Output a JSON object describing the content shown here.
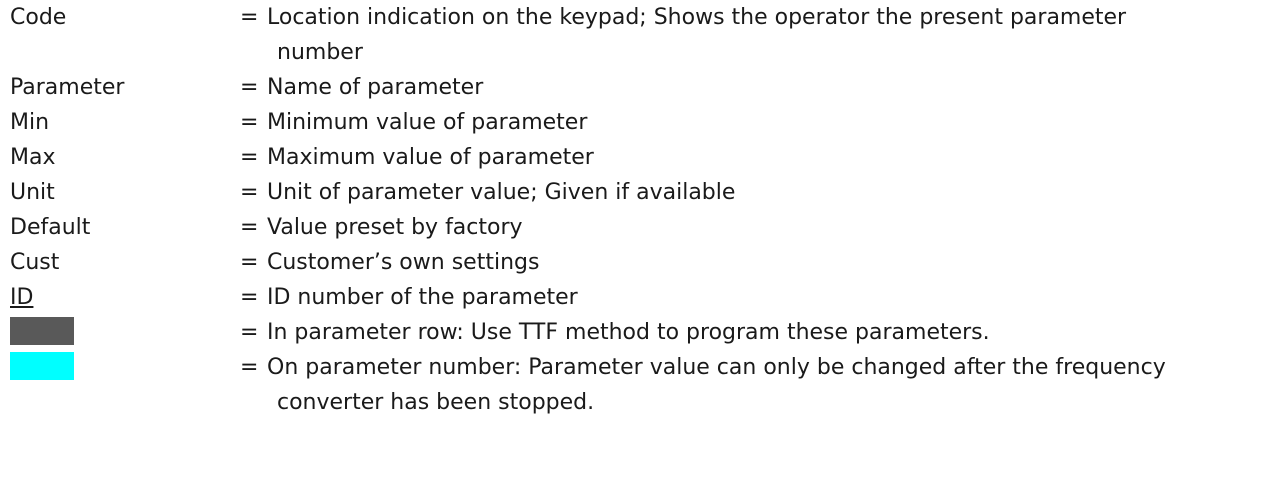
{
  "legend": [
    {
      "term": "Code",
      "definition": "Location indication on the keypad; Shows the operator the present parameter",
      "continuation": "number"
    },
    {
      "term": "Parameter",
      "definition": "Name of parameter"
    },
    {
      "term": "Min",
      "definition": "Minimum value of parameter"
    },
    {
      "term": "Max",
      "definition": "Maximum value of parameter"
    },
    {
      "term": "Unit",
      "definition": "Unit of parameter value; Given if available"
    },
    {
      "term": "Default",
      "definition": "Value preset by factory"
    },
    {
      "term": "Cust",
      "definition": "Customer’s own settings"
    },
    {
      "term": "ID",
      "definition": "ID number of the parameter"
    },
    {
      "swatch_color": "#595959",
      "definition": "In parameter row: Use TTF method to program these parameters."
    },
    {
      "swatch_color": "#00ffff",
      "definition": "On parameter number: Parameter value can only be changed after the frequency",
      "continuation": "converter has been stopped."
    }
  ],
  "equals_sign": "="
}
